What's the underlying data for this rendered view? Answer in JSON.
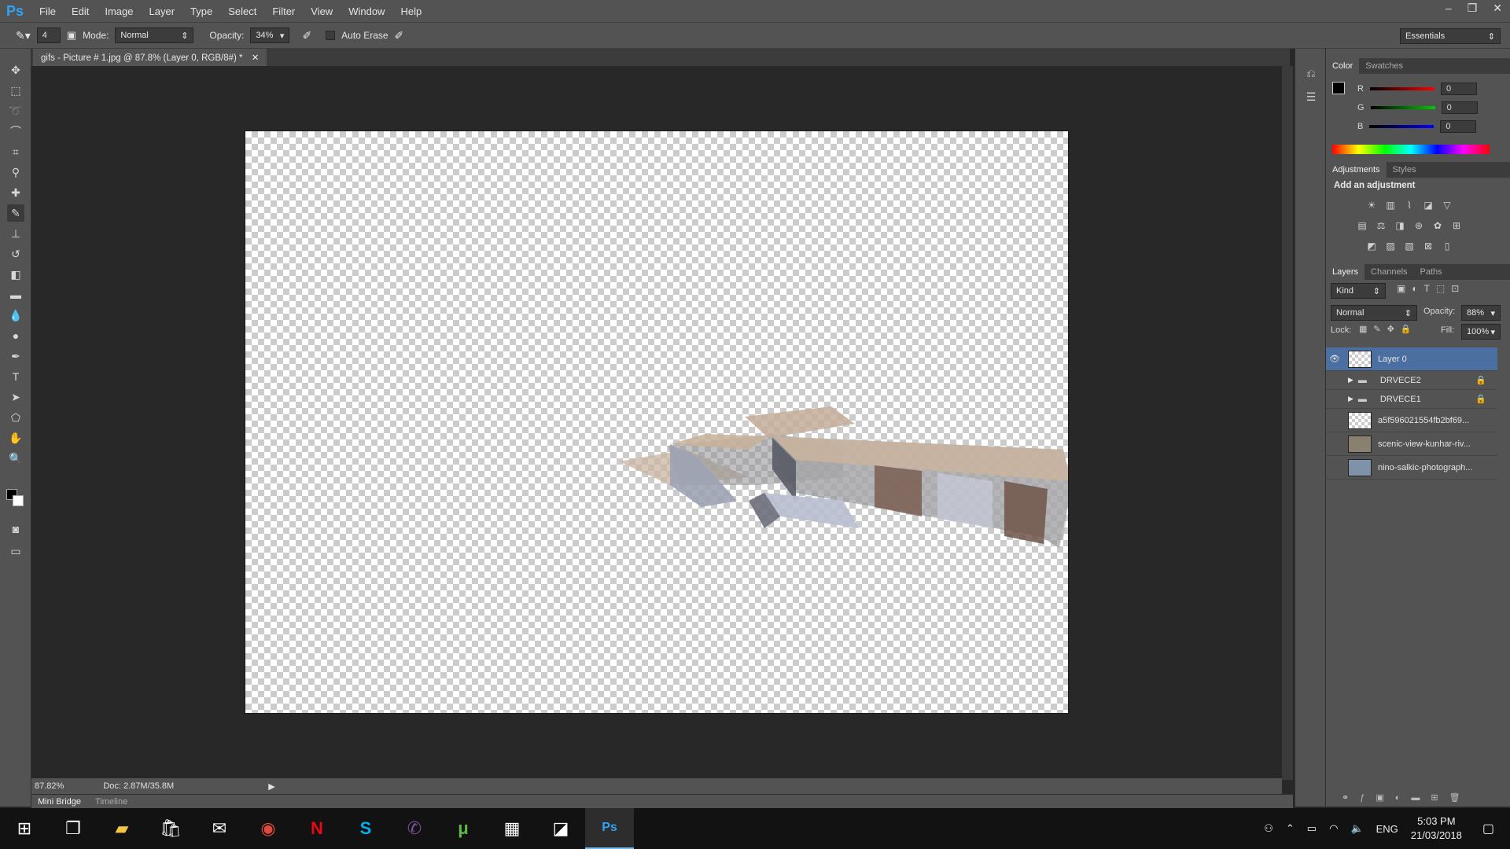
{
  "app": {
    "logo": "Ps",
    "doc_tab": "gifs - Picture # 1.jpg @ 87.8% (Layer 0, RGB/8#) *"
  },
  "menu": [
    "File",
    "Edit",
    "Image",
    "Layer",
    "Type",
    "Select",
    "Filter",
    "View",
    "Window",
    "Help"
  ],
  "window_controls": {
    "min": "–",
    "restore": "❐",
    "close": "✕"
  },
  "options": {
    "brush_size": "4",
    "mode_label": "Mode:",
    "mode_value": "Normal",
    "opacity_label": "Opacity:",
    "opacity_value": "34%",
    "auto_erase_label": "Auto Erase",
    "workspace": "Essentials"
  },
  "status": {
    "zoom": "87.82%",
    "doc": "Doc: 2.87M/35.8M"
  },
  "bottom_tabs": [
    "Mini Bridge",
    "Timeline"
  ],
  "color_panel": {
    "tabs": [
      "Color",
      "Swatches"
    ],
    "r_label": "R",
    "g_label": "G",
    "b_label": "B",
    "r": "0",
    "g": "0",
    "b": "0"
  },
  "adjustments": {
    "tabs": [
      "Adjustments",
      "Styles"
    ],
    "title": "Add an adjustment"
  },
  "layers_panel": {
    "tabs": [
      "Layers",
      "Channels",
      "Paths"
    ],
    "filter": "Kind",
    "blend_mode": "Normal",
    "opacity_label": "Opacity:",
    "opacity": "88%",
    "lock_label": "Lock:",
    "fill_label": "Fill:",
    "fill": "100%",
    "layers": [
      {
        "name": "Layer 0"
      },
      {
        "name": "DRVECE2"
      },
      {
        "name": "DRVECE1"
      },
      {
        "name": "a5f596021554fb2bf69..."
      },
      {
        "name": "scenic-view-kunhar-riv..."
      },
      {
        "name": "nino-salkic-photograph..."
      }
    ]
  },
  "taskbar": {
    "lang": "ENG",
    "time": "5:03 PM",
    "date": "21/03/2018"
  },
  "colors": {
    "accent": "#2fa3f7",
    "panel": "#535353",
    "dark": "#282828",
    "selected_layer": "#4a6fa0"
  }
}
